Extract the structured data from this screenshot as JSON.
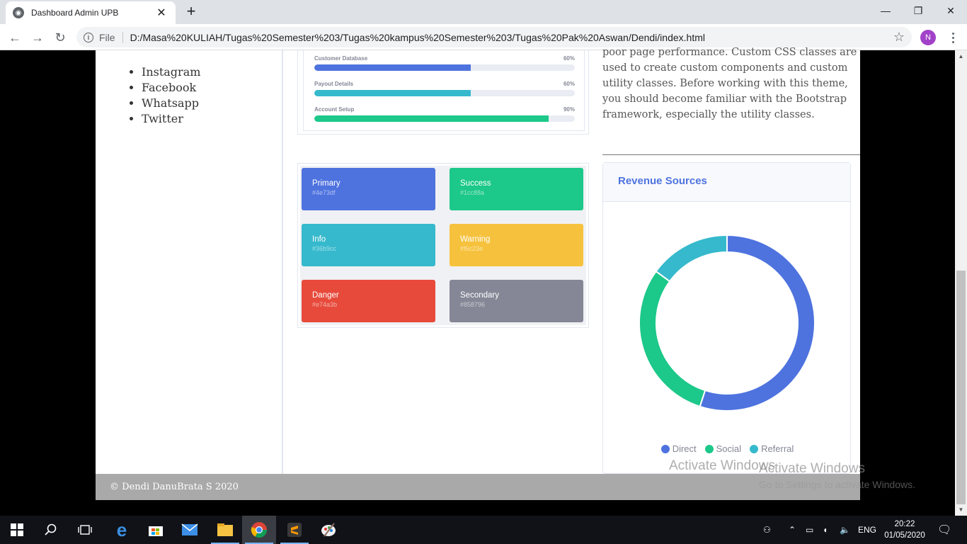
{
  "browser": {
    "tab_title": "Dashboard Admin UPB",
    "url_scheme": "File",
    "url": "D:/Masa%20KULIAH/Tugas%20Semester%203/Tugas%20kampus%20Semester%203/Tugas%20Pak%20Aswan/Dendi/index.html",
    "profile_initial": "N"
  },
  "sidebar": {
    "social_links": [
      "Instagram",
      "Facebook",
      "Whatsapp",
      "Twitter"
    ]
  },
  "progress": [
    {
      "label": "Customer Database",
      "percent_text": "60%",
      "value": 60,
      "color": "#4e73df"
    },
    {
      "label": "Payout Details",
      "percent_text": "60%",
      "value": 60,
      "color": "#36b9cc"
    },
    {
      "label": "Account Setup",
      "percent_text": "90%",
      "value": 90,
      "color": "#1cc88a"
    }
  ],
  "colors": [
    {
      "name": "Primary",
      "hex": "#4e73df"
    },
    {
      "name": "Success",
      "hex": "#1cc88a"
    },
    {
      "name": "Info",
      "hex": "#36b9cc"
    },
    {
      "name": "Warning",
      "hex": "#f6c23e"
    },
    {
      "name": "Danger",
      "hex": "#e74a3b"
    },
    {
      "name": "Secondary",
      "hex": "#858796"
    }
  ],
  "right_text": {
    "paragraph": "poor page performance. Custom CSS classes are used to create custom components and custom utility classes. Before working with this theme, you should become familiar with the Bootstrap framework, especially the utility classes."
  },
  "revenue": {
    "title": "Revenue Sources"
  },
  "chart_data": {
    "type": "pie",
    "categories": [
      "Direct",
      "Social",
      "Referral"
    ],
    "values": [
      55,
      30,
      15
    ],
    "colors": [
      "#4e73df",
      "#1cc88a",
      "#36b9cc"
    ],
    "legend": "bottom"
  },
  "footer": {
    "text": "© Dendi DanuBrata S 2020"
  },
  "watermark": {
    "line1": "Activate Windows",
    "line2": "Activate Windows",
    "line3": "Go to Settings to activate Windows."
  },
  "taskbar": {
    "time": "20:22",
    "date": "01/05/2020",
    "language": "ENG"
  }
}
